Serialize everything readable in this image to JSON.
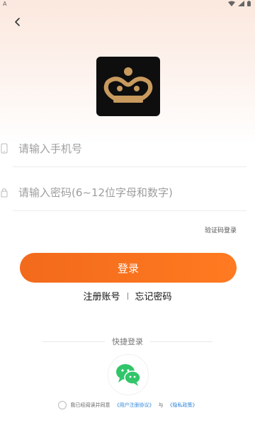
{
  "status": {
    "left_icon": "A",
    "wifi_icon": "wifi-icon",
    "signal_icon": "signal-icon",
    "battery_icon": "battery-icon"
  },
  "header": {
    "back_icon": "chevron-left-icon"
  },
  "logo": {
    "name": "app-logo",
    "bg_color": "#0e0e0e",
    "gold_color": "#c89a5e"
  },
  "form": {
    "phone_placeholder": "请输入手机号",
    "password_placeholder": "请输入密码(6~12位字母和数字)",
    "sms_login": "验证码登录"
  },
  "actions": {
    "login": "登录",
    "register": "注册账号",
    "forgot": "忘记密码"
  },
  "quick_login": {
    "label": "快捷登录",
    "wechat_icon": "wechat-icon",
    "wechat_color": "#31c56a"
  },
  "agreement": {
    "prefix": "我已经阅读并同意",
    "user_agreement": "《用户注册协议》",
    "and": "与",
    "privacy": "《隐私政策》"
  },
  "colors": {
    "accent": "#f26a1b",
    "link": "#2d84d8"
  }
}
